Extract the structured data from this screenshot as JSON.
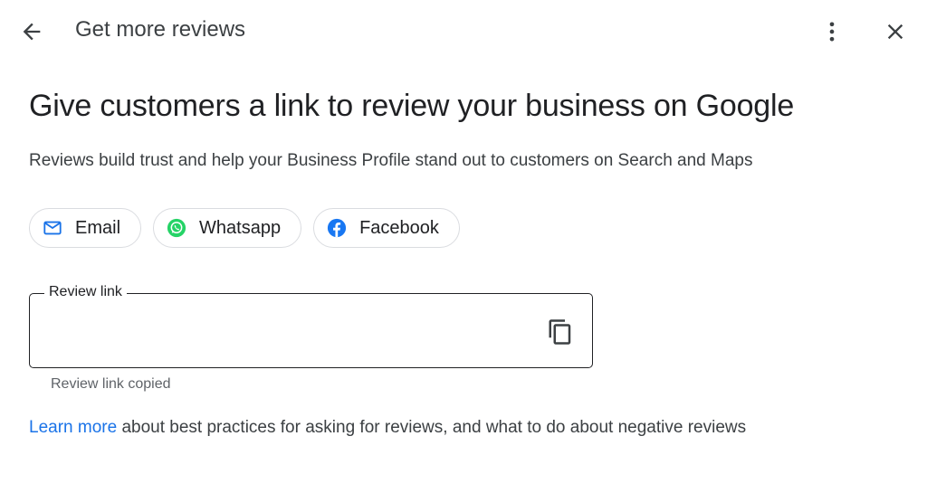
{
  "header": {
    "title": "Get more reviews",
    "back_icon": "arrow-left-icon",
    "more_icon": "more-vertical-icon",
    "close_icon": "close-icon"
  },
  "main": {
    "headline": "Give customers a link to review your business on Google",
    "subtitle": "Reviews build trust and help your Business Profile stand out to customers on Search and Maps",
    "share_chips": [
      {
        "label": "Email",
        "icon": "email-icon",
        "color": "#1a73e8"
      },
      {
        "label": "Whatsapp",
        "icon": "whatsapp-icon",
        "color": "#25d366"
      },
      {
        "label": "Facebook",
        "icon": "facebook-icon",
        "color": "#1877f2"
      }
    ],
    "review_link": {
      "label": "Review link",
      "value": "",
      "helper": "Review link copied",
      "copy_icon": "copy-icon"
    },
    "footer": {
      "link_text": "Learn more",
      "rest_text": " about best practices for asking for reviews, and what to do about negative reviews"
    }
  },
  "colors": {
    "link": "#1a73e8",
    "text": "#202124",
    "secondary_text": "#5f6368",
    "border": "#dadce0"
  }
}
